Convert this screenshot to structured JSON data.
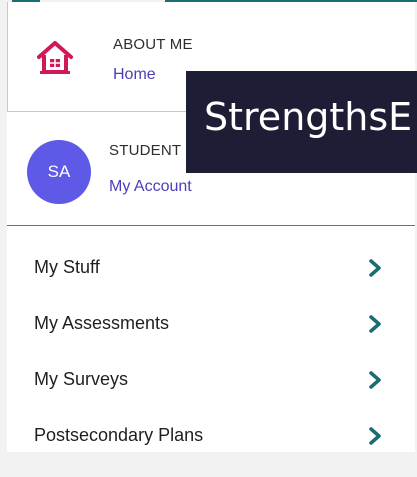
{
  "about": {
    "section_label": "ABOUT ME",
    "link_label": "Home",
    "icon": "house-icon"
  },
  "student": {
    "section_label": "STUDENT",
    "link_label": "My Account",
    "avatar_initials": "SA"
  },
  "menu": [
    {
      "label": "My Stuff",
      "icon": "chevron-right-icon"
    },
    {
      "label": "My Assessments",
      "icon": "chevron-right-icon"
    },
    {
      "label": "My Surveys",
      "icon": "chevron-right-icon"
    },
    {
      "label": "Postsecondary Plans",
      "icon": "chevron-right-icon"
    }
  ],
  "tooltip": {
    "text": "StrengthsE"
  },
  "colors": {
    "accent_teal": "#1a6d70",
    "link_purple": "#4a3fb8",
    "avatar_bg": "#5e59e6",
    "house_icon": "#d1185a",
    "tooltip_bg": "#1d1e36"
  }
}
